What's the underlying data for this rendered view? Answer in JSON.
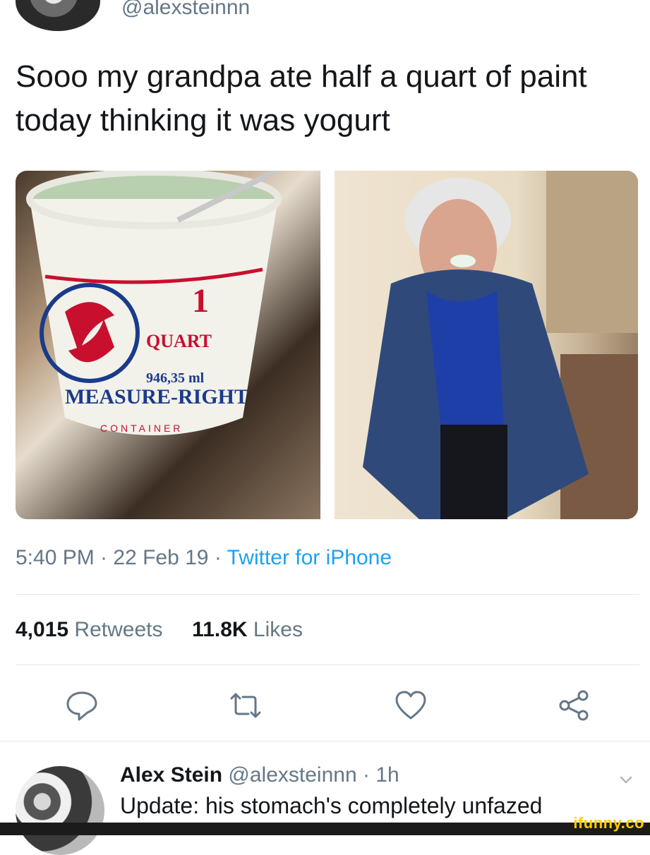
{
  "header": {
    "handle": "@alexsteinnn"
  },
  "tweet": {
    "text": "Sooo my grandpa ate half a quart of paint today thinking it was yogurt",
    "time_date": "5:40 PM · 22 Feb 19 · ",
    "client": "Twitter for iPhone",
    "retweets_count": "4,015",
    "retweets_label": "Retweets",
    "likes_count": "11.8K",
    "likes_label": "Likes"
  },
  "media": {
    "left_image": {
      "container_text": [
        "1",
        "QUART",
        "946,35 ml",
        "MEASURE-RIGHT",
        "CONTAINER"
      ]
    },
    "right_image": {}
  },
  "reply": {
    "name": "Alex Stein",
    "handle_time": "@alexsteinnn · 1h",
    "text": "Update: his stomach's completely unfazed"
  },
  "watermark": {
    "text": "ifunny.co"
  },
  "colors": {
    "accent": "#1da1f2",
    "muted": "#657786",
    "text": "#14171a",
    "divider": "#e1e8ed"
  },
  "icons": [
    "reply-icon",
    "retweet-icon",
    "like-icon",
    "share-icon",
    "chevron-down-icon"
  ]
}
